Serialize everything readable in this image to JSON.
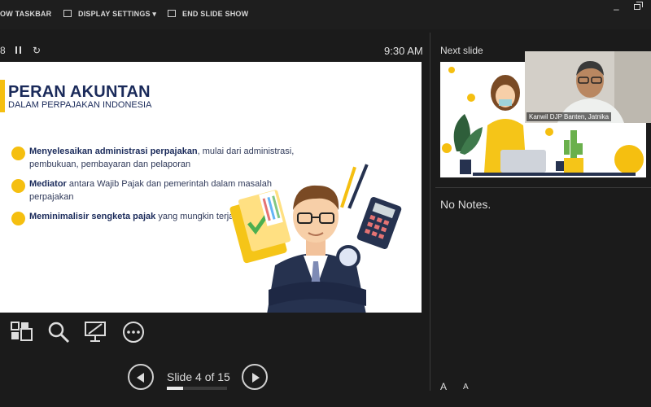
{
  "toolbar": {
    "taskbar_label": "OW TASKBAR",
    "display_settings_label": "DISPLAY SETTINGS ▾",
    "end_show_label": "END SLIDE SHOW"
  },
  "presenter": {
    "slide_num_fragment": "8",
    "clock": "9:30 AM",
    "slide_counter": "Slide 4 of 15",
    "progress_fraction": 0.2667
  },
  "slide": {
    "title": "PERAN AKUNTAN",
    "subtitle": "DALAM PERPAJAKAN INDONESIA",
    "bullets": [
      {
        "bold": "Menyelesaikan administrasi perpajakan",
        "rest": ", mulai dari administrasi, pembukuan, pembayaran dan pelaporan"
      },
      {
        "bold": "Mediator",
        "rest": " antara Wajib Pajak dan pemerintah dalam masalah perpajakan"
      },
      {
        "bold": "Meminimalisir sengketa pajak",
        "rest": " yang mungkin terjadi"
      }
    ]
  },
  "right_pane": {
    "next_label": "Next slide",
    "notes": "No Notes.",
    "font_up": "A",
    "font_down": "A"
  },
  "video": {
    "caption": "Kanwil DJP Banten, Jatnika"
  },
  "icons": {
    "thumbnails": "grid-icon",
    "zoom": "magnifier-icon",
    "pen": "screen-pen-icon",
    "more": "more-icon"
  },
  "colors": {
    "accent": "#f5bf10",
    "title": "#1a2a5a",
    "background": "#1b1b1b"
  }
}
